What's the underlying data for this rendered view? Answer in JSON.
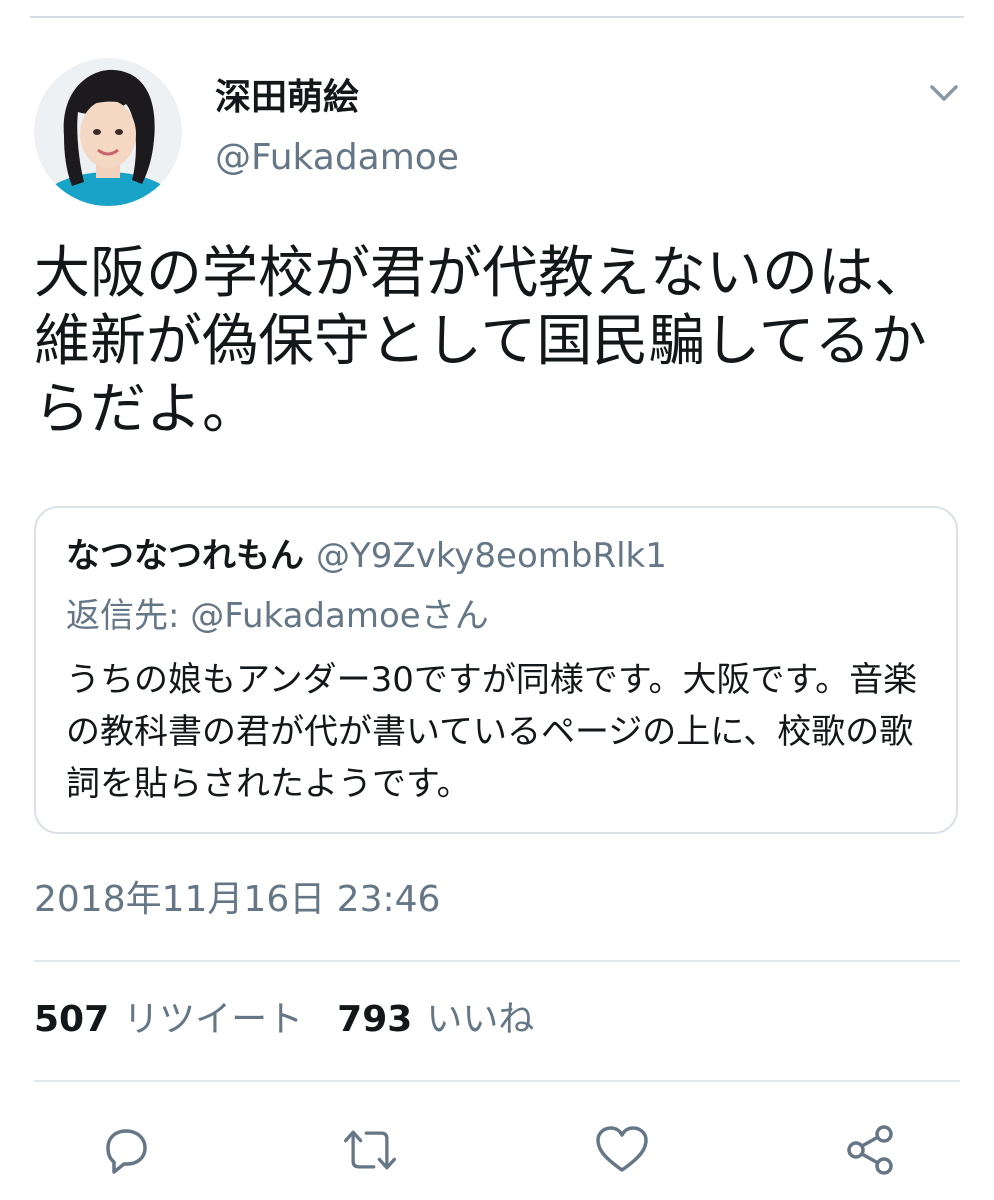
{
  "author": {
    "display_name": "深田萌絵",
    "handle": "@Fukadamoe"
  },
  "tweet": {
    "text": "大阪の学校が君が代教えないのは、維新が偽保守として国民騙してるからだよ。"
  },
  "quoted_tweet": {
    "display_name": "なつなつれもん",
    "handle": "@Y9Zvky8eombRlk1",
    "reply_to": "返信先: @Fukadamoeさん",
    "text": "うちの娘もアンダー30ですが同様です。大阪です。音楽の教科書の君が代が書いているページの上に、校歌の歌詞を貼らされたようです。"
  },
  "timestamp": "2018年11月16日 23:46",
  "stats": {
    "retweets_count": "507",
    "retweets_label": "リツイート",
    "likes_count": "793",
    "likes_label": "いいね"
  },
  "icons": {
    "menu": "chevron-down-icon",
    "reply": "reply-icon",
    "retweet": "retweet-icon",
    "like": "heart-icon",
    "share": "share-icon"
  },
  "colors": {
    "text_primary": "#14171a",
    "text_secondary": "#657786",
    "border": "#dbe1e6",
    "avatar_clothing": "#1aa3c8"
  }
}
